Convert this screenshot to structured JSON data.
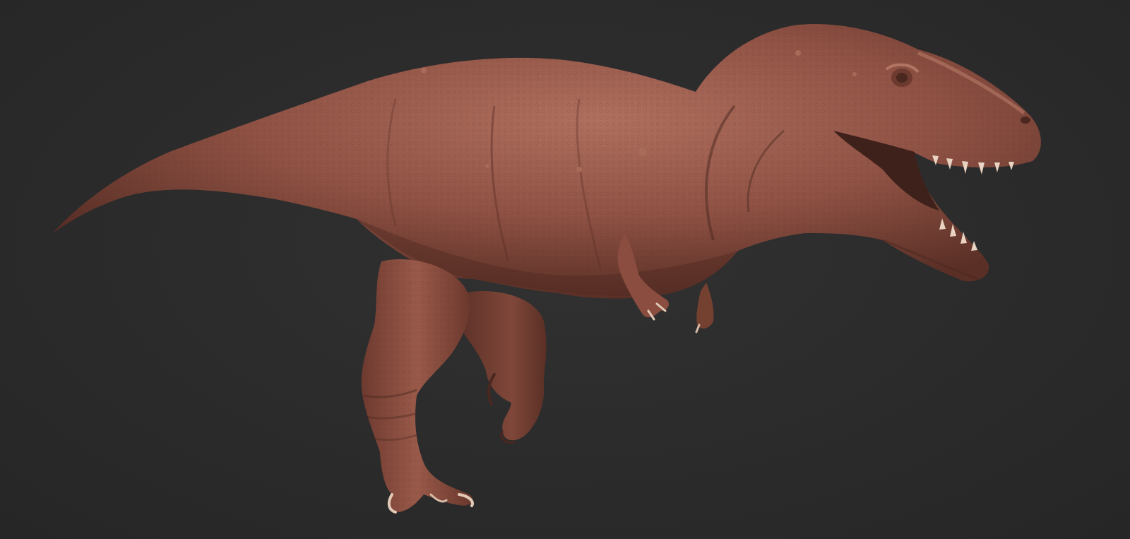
{
  "viewport": {
    "background_color": "#2b2b2b"
  },
  "subject": {
    "icon": "trex-sculpt",
    "material_color": "#8e5143",
    "highlight_color": "#b0705f",
    "shadow_color": "#5a2f26"
  }
}
